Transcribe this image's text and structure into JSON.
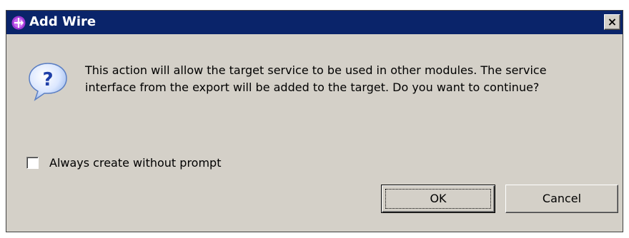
{
  "window": {
    "title": "Add Wire",
    "title_bar_color": "#0a246a",
    "close_symbol": "×",
    "app_icon": "wire-app-icon"
  },
  "message": {
    "icon": "question-icon",
    "text": "This action will allow the target service to be used in other modules. The service interface from the export will be added to the target. Do you want to continue?"
  },
  "options": {
    "always_create_label": "Always create without prompt",
    "always_create_checked": false
  },
  "buttons": {
    "ok_label": "OK",
    "cancel_label": "Cancel"
  }
}
